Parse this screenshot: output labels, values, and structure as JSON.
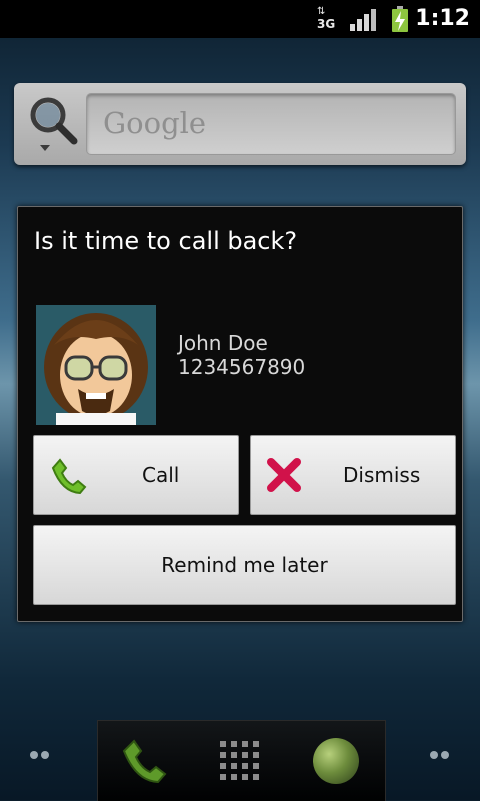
{
  "status_bar": {
    "network_type": "3G",
    "network_arrows": "⇅",
    "time": "1:12",
    "icons": [
      "data-3g-icon",
      "signal-strength-icon",
      "battery-charging-icon"
    ]
  },
  "search_widget": {
    "placeholder": "Google",
    "icon": "search-icon"
  },
  "dialog": {
    "title": "Is it time to call back?",
    "contact": {
      "name": "John Doe",
      "number": "1234567890"
    },
    "buttons": {
      "call": "Call",
      "dismiss": "Dismiss",
      "remind": "Remind me later"
    }
  },
  "dock": {
    "items": [
      "phone-icon",
      "app-drawer-icon",
      "browser-icon"
    ]
  },
  "colors": {
    "call_green": "#6fbf2a",
    "dismiss_red": "#d1124a",
    "dialog_bg": "#0b0b0b"
  }
}
